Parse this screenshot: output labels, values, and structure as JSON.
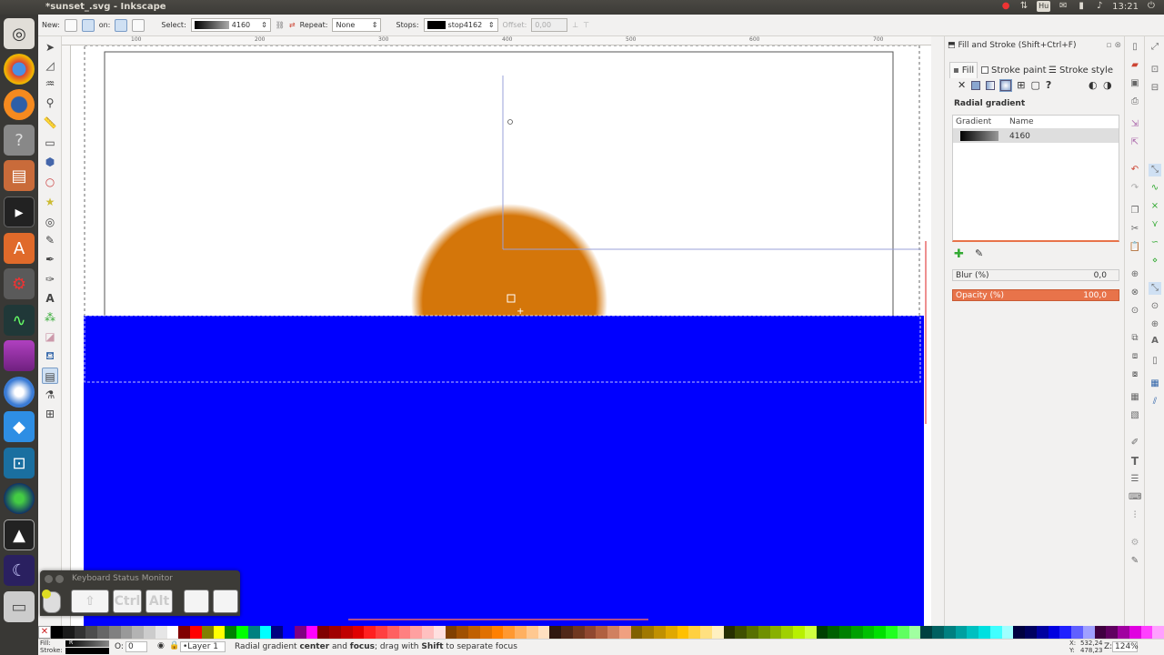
{
  "window": {
    "title": "*sunset_.svg - Inkscape"
  },
  "system_tray": {
    "hu_label": "Hu",
    "clock": "13:21"
  },
  "tool_controls": {
    "new_label": "New:",
    "on_label": "on:",
    "select_label": "Select:",
    "select_gradient": "4160",
    "repeat_label": "Repeat:",
    "repeat_value": "None",
    "stops_label": "Stops:",
    "stop_value": "stop4162",
    "offset_label": "Offset:",
    "offset_value": "0,00"
  },
  "ruler": {
    "labels": [
      "100",
      "200",
      "300",
      "400",
      "500",
      "600",
      "700"
    ]
  },
  "fill_stroke": {
    "panel_title": "Fill and Stroke (Shift+Ctrl+F)",
    "tabs": [
      {
        "label": "Fill"
      },
      {
        "label": "Stroke paint"
      },
      {
        "label": "Stroke style"
      }
    ],
    "mode_title": "Radial gradient",
    "paint_none": "✕",
    "paint_unset": "?",
    "table_headers": {
      "gradient": "Gradient",
      "name": "Name"
    },
    "gradient_rows": [
      {
        "name": "4160"
      }
    ],
    "blur_label": "Blur (%)",
    "blur_value": "0,0",
    "opacity_label": "Opacity (%)",
    "opacity_value": "100,0"
  },
  "keyboard_monitor": {
    "title": "Keyboard Status Monitor",
    "keys": [
      {
        "label": "⇧"
      },
      {
        "label": "Ctrl"
      },
      {
        "label": "Alt"
      },
      {
        "label": ""
      },
      {
        "label": ""
      }
    ]
  },
  "status_bar": {
    "fill_label": "Fill:",
    "stroke_label": "Stroke:",
    "fill_indicator": "R",
    "opacity_label": "O:",
    "opacity_value": "0",
    "layer": "•Layer 1",
    "message_prefix": "Radial gradient ",
    "message_bold1": "center",
    "message_and": " and ",
    "message_bold2": "focus",
    "message_mid": "; drag with ",
    "message_bold3": "Shift",
    "message_suffix": " to separate focus",
    "cursor_x_label": "X:",
    "cursor_x": "532,24",
    "cursor_y_label": "Y:",
    "cursor_y": "478,23",
    "zoom_label": "Z:",
    "zoom": "124%"
  },
  "colors": {
    "sea": "#0000ff",
    "sun": "#d4760a",
    "accent": "#e8734a",
    "launcher_bg": "#393835"
  },
  "palette": [
    "#000000",
    "#1a1a1a",
    "#333333",
    "#4d4d4d",
    "#666666",
    "#808080",
    "#999999",
    "#b3b3b3",
    "#cccccc",
    "#e6e6e6",
    "#ffffff",
    "#800000",
    "#ff0000",
    "#808000",
    "#ffff00",
    "#008000",
    "#00ff00",
    "#008080",
    "#00ffff",
    "#000080",
    "#0000ff",
    "#800080",
    "#ff00ff",
    "#800000",
    "#a00000",
    "#c00000",
    "#e00000",
    "#ff2020",
    "#ff4040",
    "#ff6060",
    "#ff8080",
    "#ffa0a0",
    "#ffc0c0",
    "#ffe0e0",
    "#804000",
    "#a05000",
    "#c06000",
    "#e07000",
    "#ff8000",
    "#ff9830",
    "#ffb060",
    "#ffc890",
    "#ffe0c0",
    "#301810",
    "#502818",
    "#703820",
    "#904830",
    "#b06040",
    "#d08060",
    "#f0a080",
    "#806000",
    "#a07800",
    "#c09000",
    "#e0a800",
    "#ffc000",
    "#ffd040",
    "#ffe080",
    "#fff0c0",
    "#283000",
    "#405000",
    "#587000",
    "#709000",
    "#88b000",
    "#a0d000",
    "#b8f000",
    "#cfff40",
    "#004000",
    "#006000",
    "#008000",
    "#00a000",
    "#00c000",
    "#00e000",
    "#20ff20",
    "#60ff60",
    "#a0ffa0",
    "#004040",
    "#006060",
    "#008080",
    "#00a0a0",
    "#00c0c0",
    "#00e0e0",
    "#40ffff",
    "#a0ffff",
    "#000040",
    "#000060",
    "#0000a0",
    "#0000e0",
    "#2020ff",
    "#6060ff",
    "#a0a0ff",
    "#400040",
    "#600060",
    "#a000a0",
    "#e000e0",
    "#ff40ff",
    "#ffa0ff"
  ]
}
